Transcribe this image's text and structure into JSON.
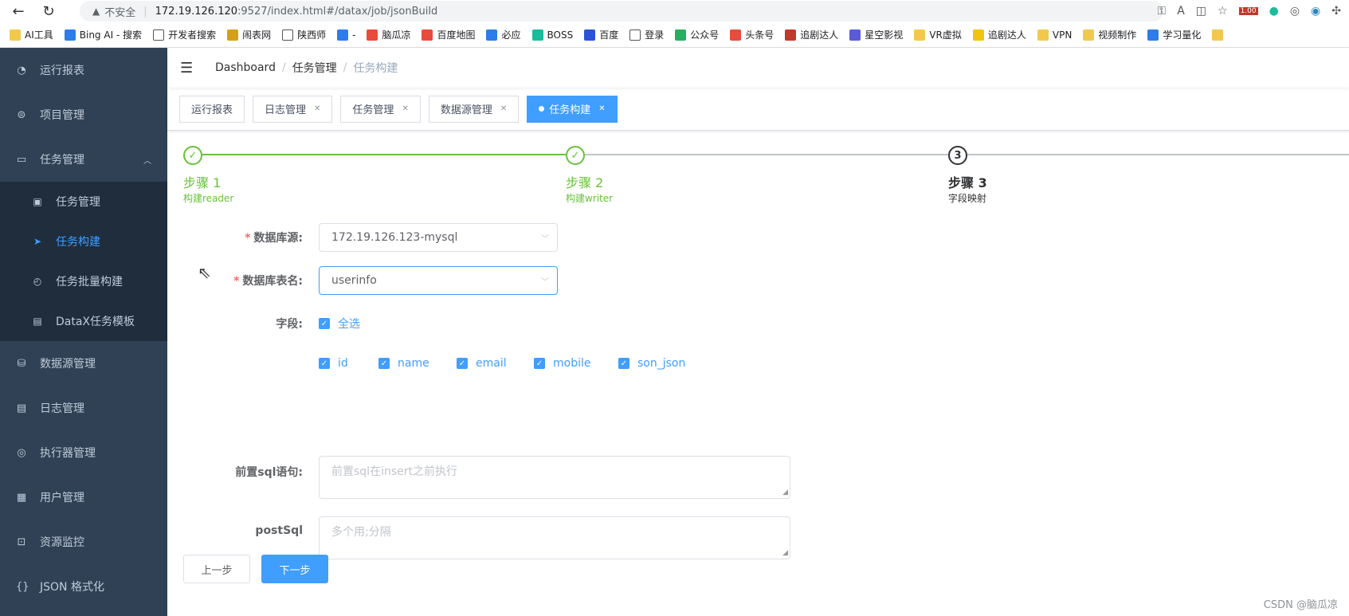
{
  "browser": {
    "insecure_label": "不安全",
    "url_host": "172.19.126.120",
    "url_path": ":9527/index.html#/datax/job/jsonBuild",
    "zoom_badge": "1.00"
  },
  "bookmarks": [
    {
      "label": "AI工具",
      "icon": "folder"
    },
    {
      "label": "Bing AI - 搜索",
      "icon": "search"
    },
    {
      "label": "开发者搜索",
      "icon": "page"
    },
    {
      "label": "闹表网",
      "icon": "cat"
    },
    {
      "label": "陕西师",
      "icon": "page"
    },
    {
      "label": "-",
      "icon": "tv"
    },
    {
      "label": "脑瓜凉",
      "icon": "c"
    },
    {
      "label": "百度地图",
      "icon": "pin"
    },
    {
      "label": "必应",
      "icon": "search"
    },
    {
      "label": "BOSS",
      "icon": "b"
    },
    {
      "label": "百度",
      "icon": "paw"
    },
    {
      "label": "登录",
      "icon": "page"
    },
    {
      "label": "公众号",
      "icon": "wechat"
    },
    {
      "label": "头条号",
      "icon": "toutiao"
    },
    {
      "label": "追剧达人",
      "icon": "film"
    },
    {
      "label": "星空影视",
      "icon": "star"
    },
    {
      "label": "VR虚拟",
      "icon": "folder"
    },
    {
      "label": "追剧达人",
      "icon": "film2"
    },
    {
      "label": "VPN",
      "icon": "folder"
    },
    {
      "label": "视频制作",
      "icon": "folder"
    },
    {
      "label": "学习量化",
      "icon": "guo"
    },
    {
      "label": "",
      "icon": "folder"
    }
  ],
  "sidebar": {
    "items": [
      {
        "label": "运行报表",
        "icon": "dashboard-icon"
      },
      {
        "label": "项目管理",
        "icon": "database-icon"
      },
      {
        "label": "任务管理",
        "icon": "monitor-icon"
      }
    ],
    "sub_items": [
      {
        "label": "任务管理",
        "icon": "calendar-icon"
      },
      {
        "label": "任务构建",
        "icon": "send-icon"
      },
      {
        "label": "任务批量构建",
        "icon": "gauge-icon"
      },
      {
        "label": "DataX任务模板",
        "icon": "clipboard-icon"
      }
    ],
    "items_after": [
      {
        "label": "数据源管理",
        "icon": "db-stack-icon"
      },
      {
        "label": "日志管理",
        "icon": "document-icon"
      },
      {
        "label": "执行器管理",
        "icon": "eye-icon"
      },
      {
        "label": "用户管理",
        "icon": "grid-icon"
      },
      {
        "label": "资源监控",
        "icon": "cast-icon"
      },
      {
        "label": "JSON 格式化",
        "icon": "braces-icon"
      }
    ]
  },
  "breadcrumb": {
    "root": "Dashboard",
    "parent": "任务管理",
    "current": "任务构建"
  },
  "tags": [
    {
      "label": "运行报表",
      "closable": false,
      "active": false
    },
    {
      "label": "日志管理",
      "closable": true,
      "active": false
    },
    {
      "label": "任务管理",
      "closable": true,
      "active": false
    },
    {
      "label": "数据源管理",
      "closable": true,
      "active": false
    },
    {
      "label": "任务构建",
      "closable": true,
      "active": true
    }
  ],
  "steps": [
    {
      "title": "步骤 1",
      "desc": "构建reader",
      "status": "done"
    },
    {
      "title": "步骤 2",
      "desc": "构建writer",
      "status": "done"
    },
    {
      "title": "步骤 3",
      "desc": "字段映射",
      "status": "current",
      "number": "3"
    }
  ],
  "form": {
    "datasource_label": "数据库源:",
    "datasource_value": "172.19.126.123-mysql",
    "table_label": "数据库表名:",
    "table_value": "userinfo",
    "fields_label": "字段:",
    "select_all": "全选",
    "fields": [
      "id",
      "name",
      "email",
      "mobile",
      "son_json"
    ],
    "presql_label": "前置sql语句:",
    "presql_placeholder": "前置sql在insert之前执行",
    "postsql_label": "postSql",
    "postsql_placeholder": "多个用;分隔"
  },
  "buttons": {
    "prev": "上一步",
    "next": "下一步"
  },
  "watermark": "CSDN @脑瓜凉",
  "colors": {
    "sidebar_bg": "#304156",
    "submenu_bg": "#1f2d3d",
    "primary": "#409eff",
    "success": "#67c23a"
  }
}
